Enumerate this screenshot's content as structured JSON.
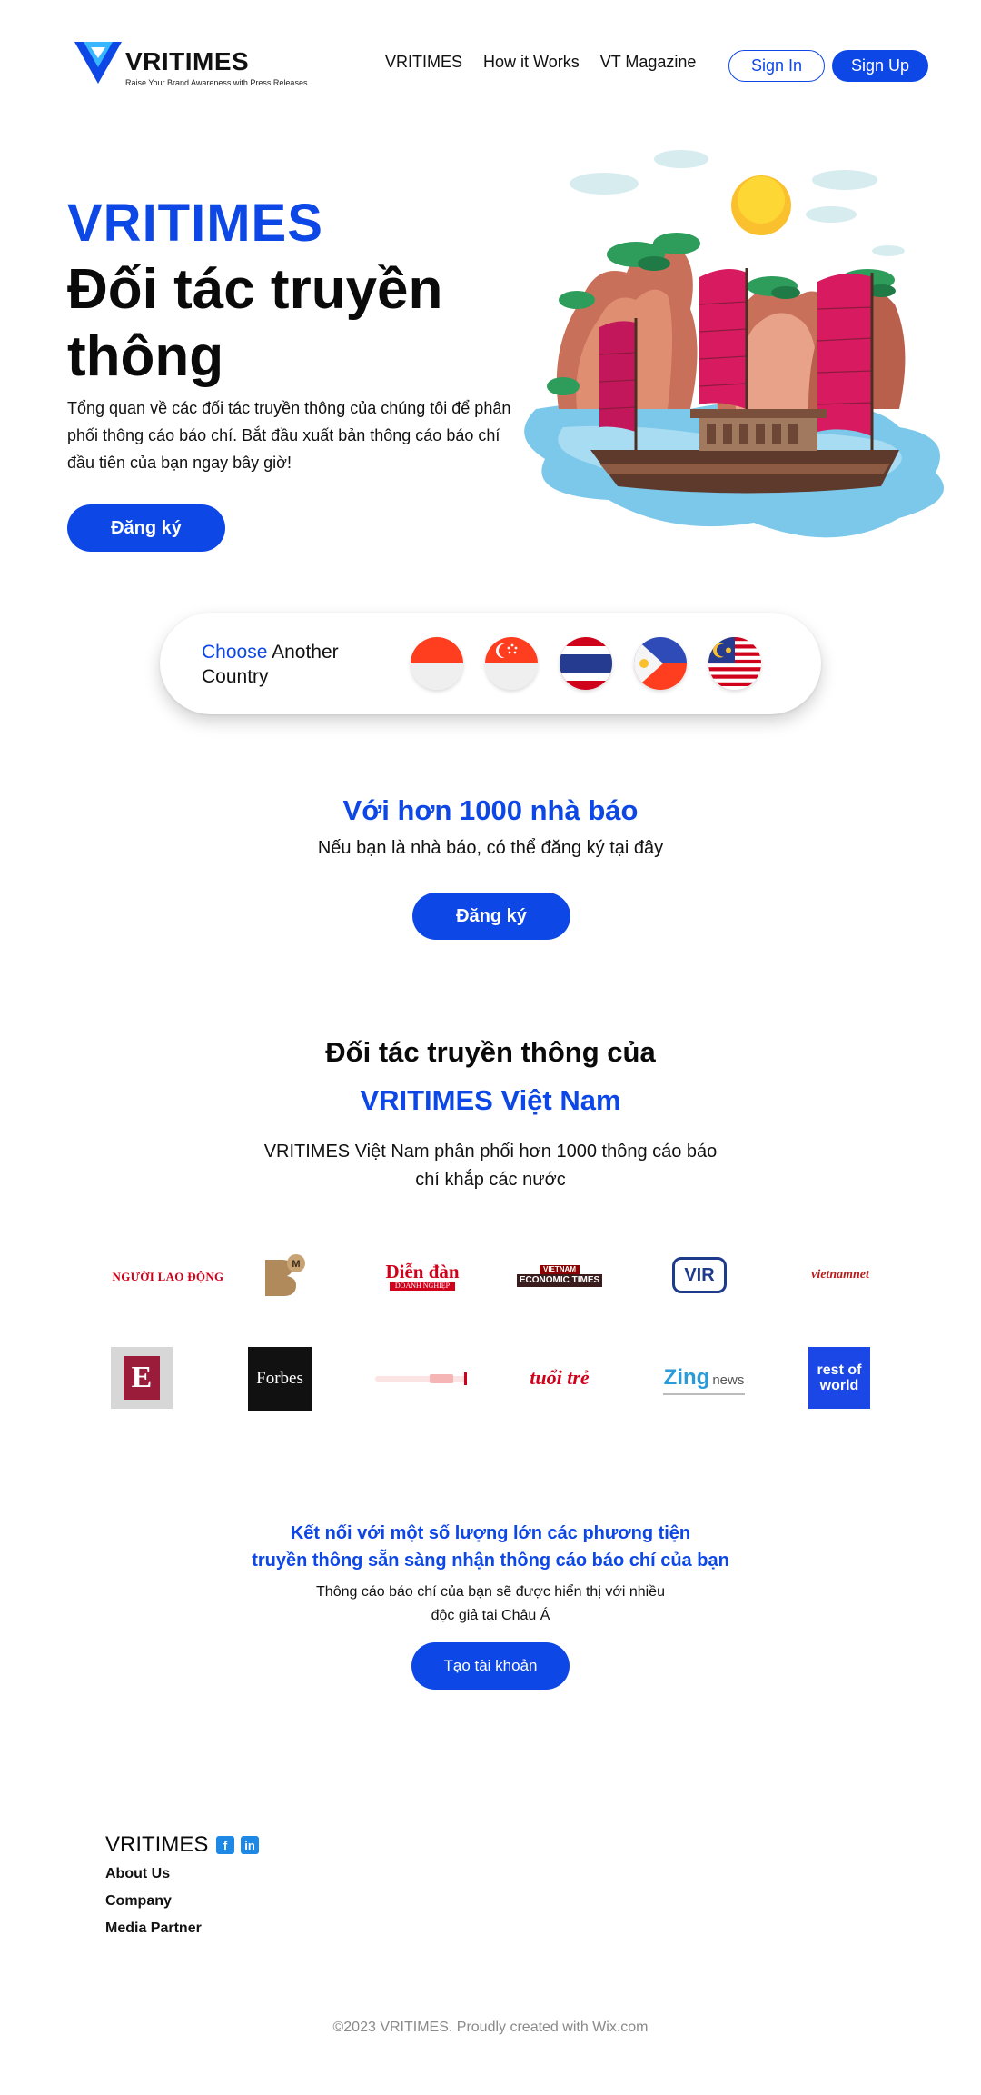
{
  "header": {
    "logo_text": "VRITIMES",
    "logo_tagline": "Raise Your Brand Awareness with Press Releases",
    "nav": [
      "VRITIMES",
      "How it Works",
      "VT Magazine"
    ],
    "sign_in": "Sign In",
    "sign_up": "Sign Up"
  },
  "hero": {
    "brand": "VRITIMES",
    "title": "Đối tác truyền thông",
    "description": "Tổng quan về các đối tác truyền thông của chúng tôi để phân phối thông cáo báo chí. Bắt đầu xuất bản thông cáo báo chí đầu tiên của bạn ngay bây giờ!",
    "cta": "Đăng ký"
  },
  "country": {
    "choose": "Choose",
    "another": "Another",
    "country": "Country",
    "flags": [
      "indonesia-flag",
      "singapore-flag",
      "thailand-flag",
      "philippines-flag",
      "malaysia-flag"
    ]
  },
  "journalists": {
    "title": "Với hơn 1000 nhà báo",
    "subtitle": "Nếu bạn là nhà báo, có thể đăng ký tại đây",
    "cta": "Đăng ký"
  },
  "partners": {
    "title": "Đối tác truyền thông của",
    "brand": "VRITIMES Việt Nam",
    "description": "VRITIMES Việt Nam phân phối hơn 1000 thông cáo báo chí khắp các nước",
    "logos_row1": [
      "NGƯỜI LAO ĐỘNG",
      "M",
      "Diễn đàn",
      "DOANH NGHIỆP",
      "VIETNAM",
      "ECONOMIC TIMES",
      "VIR",
      "vietnamnet"
    ],
    "logos_row2": [
      "E",
      "Forbes",
      "tuổi trẻ",
      "Zing",
      "news",
      "rest of world"
    ]
  },
  "connect": {
    "title_line1": "Kết nối với một số lượng lớn các phương tiện",
    "title_line2": "truyền thông sẵn sàng nhận thông cáo báo chí của bạn",
    "desc_line1": "Thông cáo báo chí của bạn sẽ được hiển thị với nhiều",
    "desc_line2": "độc giả tại Châu Á",
    "cta": "Tạo tài khoản"
  },
  "footer": {
    "brand": "VRITIMES",
    "links": [
      "About Us",
      "Company",
      "Media Partner"
    ],
    "copyright": "©2023 VRITIMES. Proudly created with Wix.com"
  },
  "colors": {
    "accent": "#0d47e6"
  }
}
